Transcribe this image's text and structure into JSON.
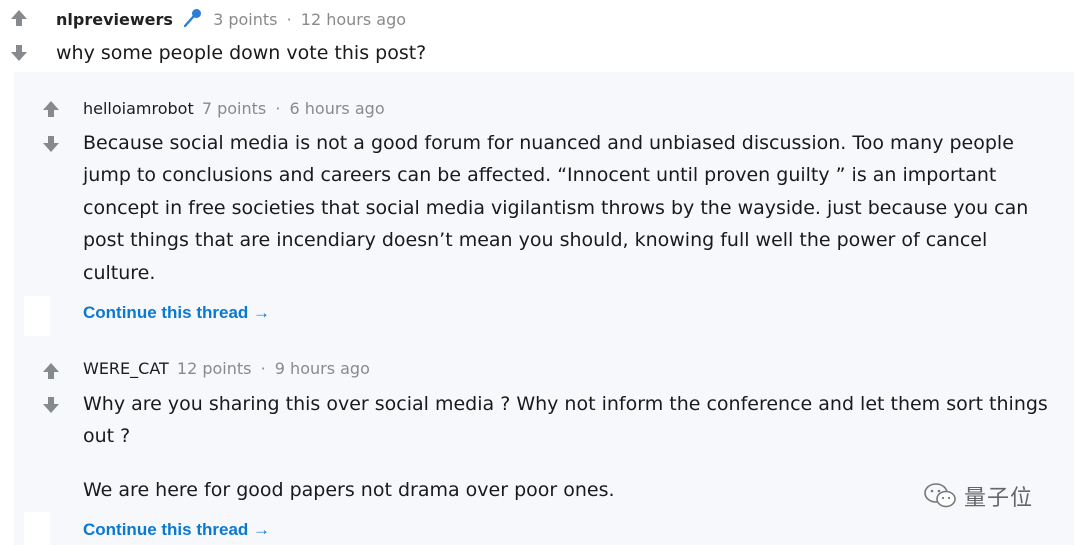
{
  "post": {
    "author": "nlpreviewers",
    "flair_icon": "microphone-icon",
    "score": "3 points",
    "separator": "·",
    "time": "12 hours ago",
    "text": "why some people down vote this post?"
  },
  "comments": [
    {
      "author": "helloiamrobot",
      "score": "7 points",
      "separator": "·",
      "time": "6 hours ago",
      "paragraphs": [
        "Because social media is not a good forum for nuanced and unbiased discussion. Too many people jump to conclusions and careers can be affected. “Innocent until proven guilty ” is an important concept in free societies that social media vigilantism throws by the wayside. just because you can post things that are incendiary doesn’t mean you should, knowing full well the power of cancel culture."
      ],
      "continue_label": "Continue this thread →"
    },
    {
      "author": "WERE_CAT",
      "score": "12 points",
      "separator": "·",
      "time": "9 hours ago",
      "paragraphs": [
        "Why are you sharing this over social media ? Why not inform the conference and let them sort things out ?",
        "We are here for good papers not drama over poor ones."
      ],
      "continue_label": "Continue this thread →"
    }
  ],
  "watermark": {
    "icon": "wechat-icon",
    "text": "量子位"
  },
  "colors": {
    "arrow": "#878a8c",
    "link": "#0a79d1",
    "thread_bg": "#f6f8fb",
    "muted": "#8a8a8a",
    "flair": "#2a7fd4"
  }
}
